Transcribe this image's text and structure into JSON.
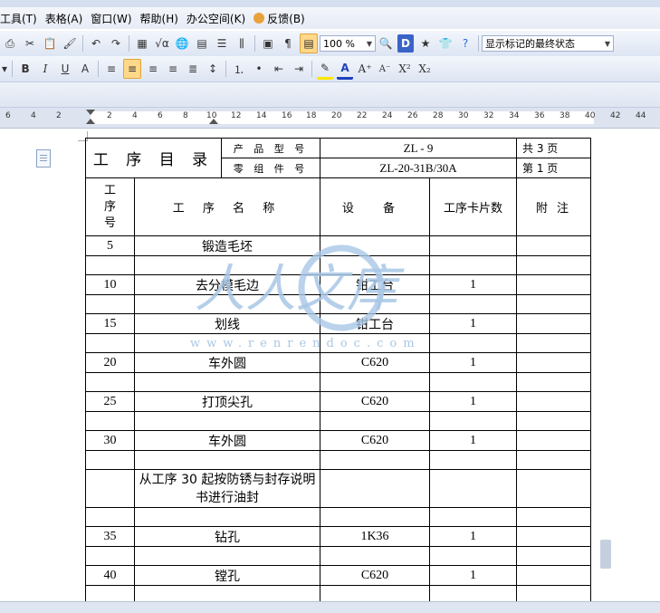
{
  "menu": {
    "items": [
      "工具(T)",
      "表格(A)",
      "窗口(W)",
      "帮助(H)",
      "办公空间(K)",
      "反馈(B)"
    ]
  },
  "toolbar": {
    "zoom": "100 %",
    "track_changes_mode": "显示标记的最终状态"
  },
  "ruler": {
    "ticks": [
      "6",
      "4",
      "2",
      "2",
      "4",
      "6",
      "8",
      "10",
      "12",
      "14",
      "16",
      "18",
      "20",
      "22",
      "24",
      "26",
      "28",
      "30",
      "32",
      "34",
      "36",
      "38",
      "40",
      "42",
      "44"
    ]
  },
  "document": {
    "header": {
      "title": "工 序 目 录",
      "product_model_label": "产 品 型 号",
      "product_model_value": "ZL - 9",
      "part_number_label": "零 组 件 号",
      "part_number_value": "ZL-20-31B/30A",
      "total_pages": "共 3 页",
      "page_number": "第 1 页"
    },
    "columns": {
      "seq": "工序号",
      "name": "工 序 名 称",
      "equipment": "设 备",
      "cards": "工序卡片数",
      "remark": "附 注"
    },
    "rows": [
      {
        "seq": "5",
        "name": "锻造毛坯",
        "equipment": "",
        "cards": "",
        "remark": ""
      },
      {
        "seq": "",
        "name": "",
        "equipment": "",
        "cards": "",
        "remark": ""
      },
      {
        "seq": "10",
        "name": "去分模毛边",
        "equipment": "钳工台",
        "cards": "1",
        "remark": ""
      },
      {
        "seq": "",
        "name": "",
        "equipment": "",
        "cards": "",
        "remark": ""
      },
      {
        "seq": "15",
        "name": "划线",
        "equipment": "钳工台",
        "cards": "1",
        "remark": ""
      },
      {
        "seq": "",
        "name": "",
        "equipment": "",
        "cards": "",
        "remark": ""
      },
      {
        "seq": "20",
        "name": "车外圆",
        "equipment": "C620",
        "cards": "1",
        "remark": ""
      },
      {
        "seq": "",
        "name": "",
        "equipment": "",
        "cards": "",
        "remark": ""
      },
      {
        "seq": "25",
        "name": "打顶尖孔",
        "equipment": "C620",
        "cards": "1",
        "remark": ""
      },
      {
        "seq": "",
        "name": "",
        "equipment": "",
        "cards": "",
        "remark": ""
      },
      {
        "seq": "30",
        "name": "车外圆",
        "equipment": "C620",
        "cards": "1",
        "remark": ""
      },
      {
        "seq": "",
        "name": "",
        "equipment": "",
        "cards": "",
        "remark": ""
      },
      {
        "seq": "",
        "name": "从工序 30 起按防锈与封存说明书进行油封",
        "equipment": "",
        "cards": "",
        "remark": ""
      },
      {
        "seq": "",
        "name": "",
        "equipment": "",
        "cards": "",
        "remark": ""
      },
      {
        "seq": "35",
        "name": "钻孔",
        "equipment": "1K36",
        "cards": "1",
        "remark": ""
      },
      {
        "seq": "",
        "name": "",
        "equipment": "",
        "cards": "",
        "remark": ""
      },
      {
        "seq": "40",
        "name": "镗孔",
        "equipment": "C620",
        "cards": "1",
        "remark": ""
      },
      {
        "seq": "",
        "name": "",
        "equipment": "",
        "cards": "",
        "remark": ""
      }
    ]
  },
  "watermark": {
    "cn": "人人文库",
    "url": "www.renrendoc.com"
  },
  "colors": {
    "watermark": "#a9c7e6",
    "toolbar_bg": "#e3e9f4",
    "active_button": "#ffd88a"
  }
}
